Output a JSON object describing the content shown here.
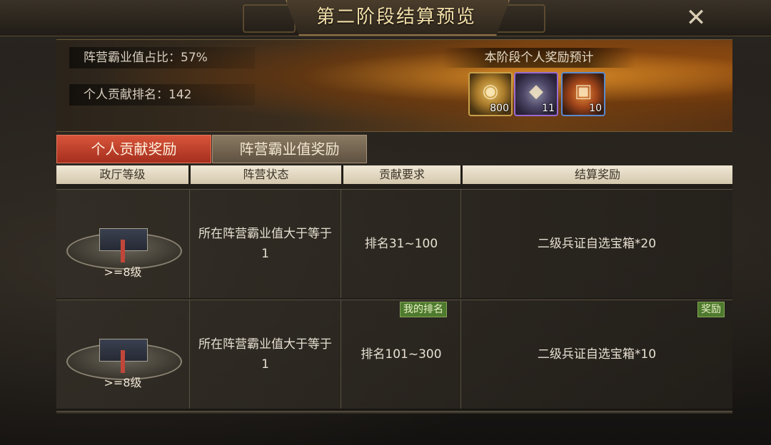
{
  "window": {
    "title": "第二阶段结算预览",
    "close_label": "✕"
  },
  "banner": {
    "faction_share": "阵营霸业值占比：57%",
    "personal_rank": "个人贡献排名：142",
    "reward_preview_title": "本阶段个人奖励预计",
    "items": [
      {
        "name": "gold-coin",
        "qty": "800"
      },
      {
        "name": "iron-ingot",
        "qty": "11"
      },
      {
        "name": "treasure-chest",
        "qty": "10"
      }
    ]
  },
  "tabs": [
    {
      "label": "个人贡献奖励",
      "active": true
    },
    {
      "label": "阵营霸业值奖励",
      "active": false
    }
  ],
  "table": {
    "headers": [
      "政厅等级",
      "阵营状态",
      "贡献要求",
      "结算奖励"
    ],
    "rows": [
      {
        "level": ">=8级",
        "status": "所在阵营霸业值大于等于1",
        "requirement": "排名31~100",
        "reward": "二级兵证自选宝箱*20"
      },
      {
        "level": ">=8级",
        "status": "所在阵营霸业值大于等于1",
        "requirement": "排名101~300",
        "reward": "二级兵证自选宝箱*10",
        "rank_badge": "我的排名",
        "reward_badge": "奖励"
      }
    ]
  },
  "colors": {
    "active_tab": "#c1402a",
    "inactive_tab": "#7a6c56",
    "badge": "#4e7a2e",
    "title_text": "#f3dfa9"
  }
}
